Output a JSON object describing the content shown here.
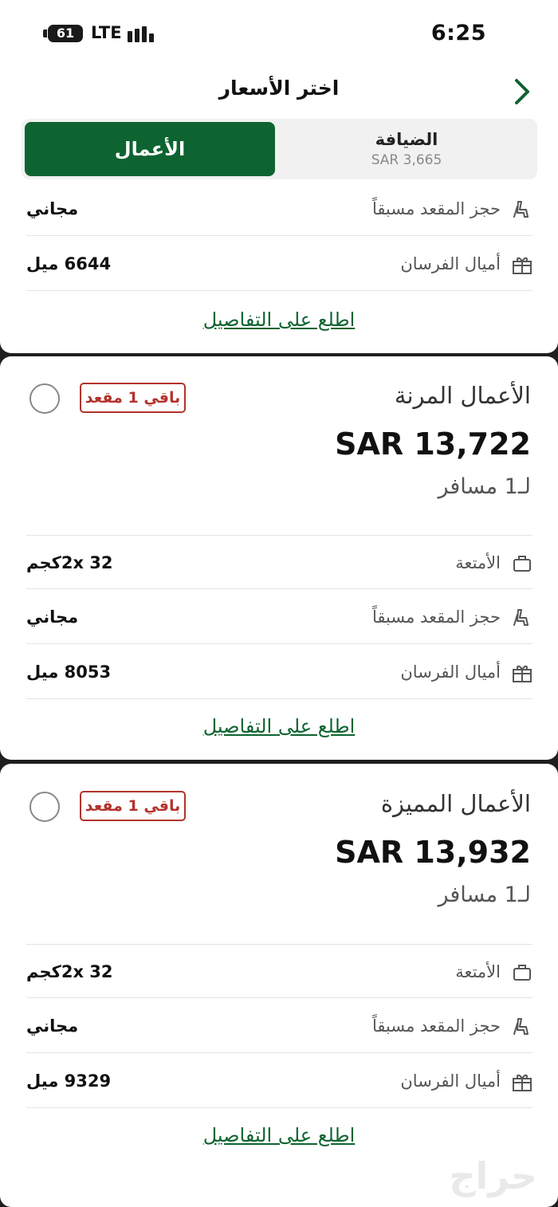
{
  "status_bar": {
    "time": "6:25",
    "battery": "61",
    "network": "LTE"
  },
  "header": {
    "title": "اختر الأسعار",
    "back_icon": "chevron-right-icon"
  },
  "cabin_tabs": {
    "business": {
      "label": "الأعمال"
    },
    "economy": {
      "label": "الضيافة",
      "price": "SAR 3,665"
    }
  },
  "top_card": {
    "rows": [
      {
        "label": "حجز المقعد مسبقاً",
        "value": "مجاني",
        "icon": "seat-icon"
      },
      {
        "label": "أميال الفرسان",
        "value": "6644 ميل",
        "icon": "gift-icon"
      }
    ],
    "details_link": "اطلع على التفاصيل"
  },
  "fares": [
    {
      "title": "الأعمال المرنة",
      "price": "SAR 13,722",
      "per_passenger": "لـ1 مسافر",
      "badge": "باقي 1 مقعد",
      "rows": [
        {
          "label": "الأمتعة",
          "value": "2x 32كجم",
          "icon": "luggage-icon"
        },
        {
          "label": "حجز المقعد مسبقاً",
          "value": "مجاني",
          "icon": "seat-icon"
        },
        {
          "label": "أميال الفرسان",
          "value": "8053 ميل",
          "icon": "gift-icon"
        }
      ],
      "details_link": "اطلع على التفاصيل"
    },
    {
      "title": "الأعمال المميزة",
      "price": "SAR 13,932",
      "per_passenger": "لـ1 مسافر",
      "badge": "باقي 1 مقعد",
      "rows": [
        {
          "label": "الأمتعة",
          "value": "2x 32كجم",
          "icon": "luggage-icon"
        },
        {
          "label": "حجز المقعد مسبقاً",
          "value": "مجاني",
          "icon": "seat-icon"
        },
        {
          "label": "أميال الفرسان",
          "value": "9329 ميل",
          "icon": "gift-icon"
        }
      ],
      "details_link": "اطلع على التفاصيل"
    }
  ],
  "watermark": "حراج",
  "colors": {
    "brand_green": "#0e6430",
    "badge_red": "#b3332b",
    "background": "#1f1f1f"
  }
}
